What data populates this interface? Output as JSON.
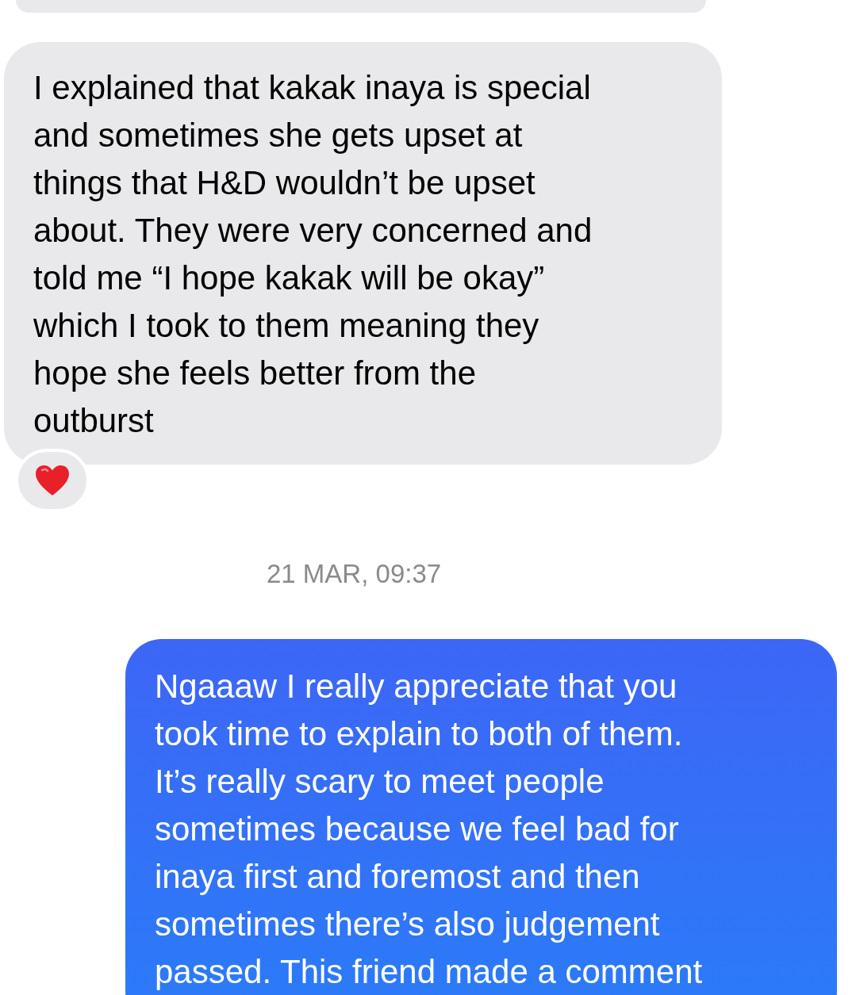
{
  "messages": [
    {
      "kind": "incoming-partial"
    },
    {
      "kind": "incoming",
      "reacted": true,
      "lines": [
        "I explained that kakak inaya is special",
        "and sometimes she gets upset at",
        "things that H&D wouldn’t be upset",
        "about. They were very concerned and",
        "told me “I hope kakak will be okay”",
        "which I took to them meaning they",
        "hope she feels better from the",
        "outburst"
      ]
    },
    {
      "kind": "timestamp",
      "text": "21 MAR, 09:37"
    },
    {
      "kind": "outgoing",
      "lines": [
        "Ngaaaw I really appreciate that you",
        "took time to explain to both of them.",
        "It’s really scary to meet people",
        "sometimes because we feel bad for",
        "inaya first and foremost and then",
        "sometimes there’s also judgement",
        "passed. This friend made a comment"
      ]
    }
  ]
}
